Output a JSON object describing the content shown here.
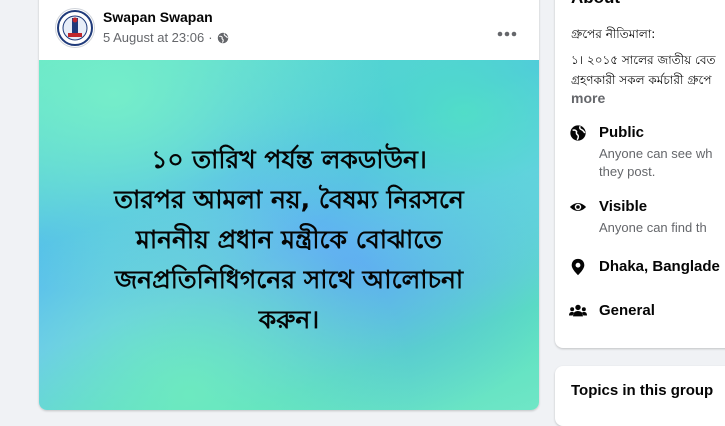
{
  "post": {
    "author": "Swapan Swapan",
    "timestamp": "5 August at 23:06",
    "separator": "·",
    "text_lines": [
      "১০ তারিখ পর্যন্ত লকডাউন।",
      "তারপর আমলা নয়, বৈষম্য নিরসনে",
      "মাননীয় প্রধান মন্ত্রীকে বোঝাতে",
      "জনপ্রতিনিধিগনের সাথে আলোচনা",
      "করুন।"
    ]
  },
  "about": {
    "title": "About",
    "rules_label": "গ্রুপের নীতিমালা:",
    "rules_line1": "১। ২০১৫ সালের জাতীয় বেত",
    "rules_line2": "গ্রহণকারী সকল কর্মচারী গ্রুপে",
    "more_label": "more",
    "items": [
      {
        "icon": "globe-icon",
        "title": "Public",
        "desc_lines": [
          "Anyone can see wh",
          "they post."
        ]
      },
      {
        "icon": "eye-icon",
        "title": "Visible",
        "desc_lines": [
          "Anyone can find th"
        ]
      },
      {
        "icon": "location-pin-icon",
        "title": "Dhaka, Banglade",
        "desc_lines": []
      },
      {
        "icon": "people-icon",
        "title": "General",
        "desc_lines": []
      }
    ]
  },
  "topics": {
    "title": "Topics in this group"
  },
  "colors": {
    "background": "#f0f2f5",
    "secondary_text": "#65676b",
    "primary_text": "#050505"
  }
}
